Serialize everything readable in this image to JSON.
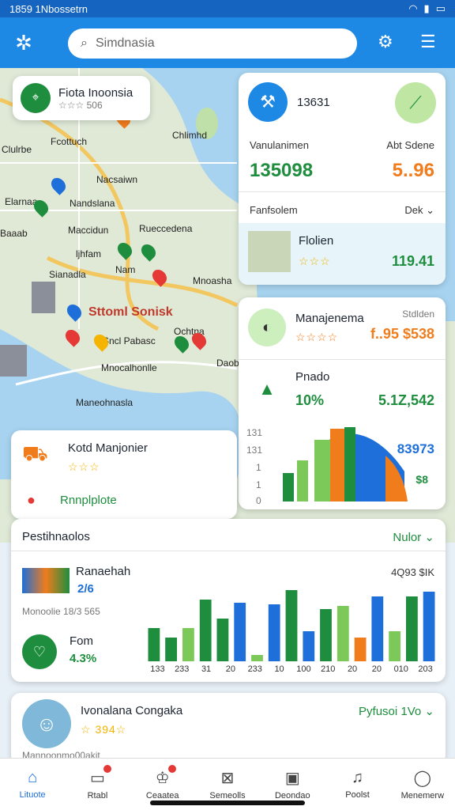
{
  "status_bar": {
    "time": "1859 1Nbossetrn",
    "icons": [
      "wifi-icon",
      "signal-icon",
      "battery-icon"
    ]
  },
  "search": {
    "placeholder": "Simdnasia"
  },
  "map": {
    "location_card": {
      "title": "Fiota Inoonsia",
      "rating_text": "☆☆☆ 506"
    },
    "labels": [
      "Fiota Inoonsia",
      "Fcottuch",
      "Nacsaiwn",
      "Elarnaa",
      "Nandslana",
      "Baaab",
      "Maccidun",
      "Rueccedena",
      "ljhfam",
      "Sianadla",
      "Nam",
      "Mnoasha",
      "Sttoml Sonisk",
      "Sncl Pabasc",
      "Mnocalhonlle",
      "Maneohnasla",
      "Chlimhd",
      "Ochtna",
      "Daoba",
      "Clulrbe"
    ]
  },
  "right_panel_top": {
    "header_value": "13631",
    "label_left": "Vanulanimen",
    "label_right": "Abt Sdene",
    "value_left": "135098",
    "value_right": "5..96",
    "section_label": "Fanfsolem",
    "section_action": "Dek",
    "sub_item": {
      "title": "Flolien",
      "rating_text": "☆☆☆",
      "value": "119.41"
    }
  },
  "right_panel_mid": {
    "title": "Manajenema",
    "value_text": "f..95 $538",
    "rating_text": "☆☆☆☆",
    "top_right": "Stdlden",
    "label": "Pnado",
    "pct": "10%",
    "number": "5.1Z,542",
    "chart_value": "83973",
    "chart_unit": "$8",
    "ticks": [
      "131",
      "131",
      "1",
      "1",
      "0"
    ]
  },
  "left_panel": {
    "title": "Kotd Manjonier",
    "rating_text": "☆☆☆",
    "link": "Rnnplplote"
  },
  "stats_panel": {
    "title": "Pestihnaolos",
    "action": "Nulor",
    "item1": {
      "title": "Ranaehah",
      "value": "2/6",
      "desc": "Monoolie 18/3 565"
    },
    "top_value": "4Q93 $IK",
    "item2": {
      "title": "Fom",
      "value": "4.3%"
    },
    "x_labels": [
      "133",
      "233",
      "31",
      "20",
      "233",
      "10",
      "100",
      "210",
      "20",
      "20",
      "010",
      "203"
    ]
  },
  "chart_data": {
    "type": "bar",
    "categories": [
      "133",
      "233",
      "31",
      "20",
      "233",
      "10",
      "100",
      "210",
      "20",
      "20",
      "010",
      "203"
    ],
    "series": [
      {
        "values": [
          42,
          30,
          42,
          78,
          54,
          74,
          8,
          72,
          90,
          38,
          66,
          70,
          30,
          82,
          38,
          82,
          88
        ]
      }
    ],
    "colors": [
      "#1e8e3e",
      "#1e8e3e",
      "#7cc95a",
      "#1e8e3e",
      "#1e8e3e",
      "#1e6fd9",
      "#7cc95a",
      "#1e6fd9",
      "#1e8e3e",
      "#1e6fd9",
      "#1e8e3e",
      "#7cc95a",
      "#f07c1c",
      "#1e6fd9",
      "#7cc95a",
      "#1e8e3e",
      "#1e6fd9"
    ]
  },
  "bottom_card": {
    "title": "Ivonalana Congaka",
    "rating_text": "☆ 394☆",
    "right": "Pyfusoi 1Vo",
    "footer": "Mannoonmo00akit"
  },
  "bottom_nav": [
    {
      "label": "Lituote",
      "icon": "home-icon",
      "active": true
    },
    {
      "label": "Rtabl",
      "icon": "tv-icon",
      "badge": true
    },
    {
      "label": "Ceaatea",
      "icon": "crown-icon",
      "badge": true
    },
    {
      "label": "Semeolls",
      "icon": "parcel-icon"
    },
    {
      "label": "Deondao",
      "icon": "calendar-icon"
    },
    {
      "label": "Poolst",
      "icon": "bell-icon"
    },
    {
      "label": "Menemerw",
      "icon": "user-icon"
    }
  ],
  "colors": {
    "primary": "#1e88e5",
    "green": "#1e8e3e",
    "orange": "#f07c1c",
    "blue": "#1e6fd9"
  }
}
